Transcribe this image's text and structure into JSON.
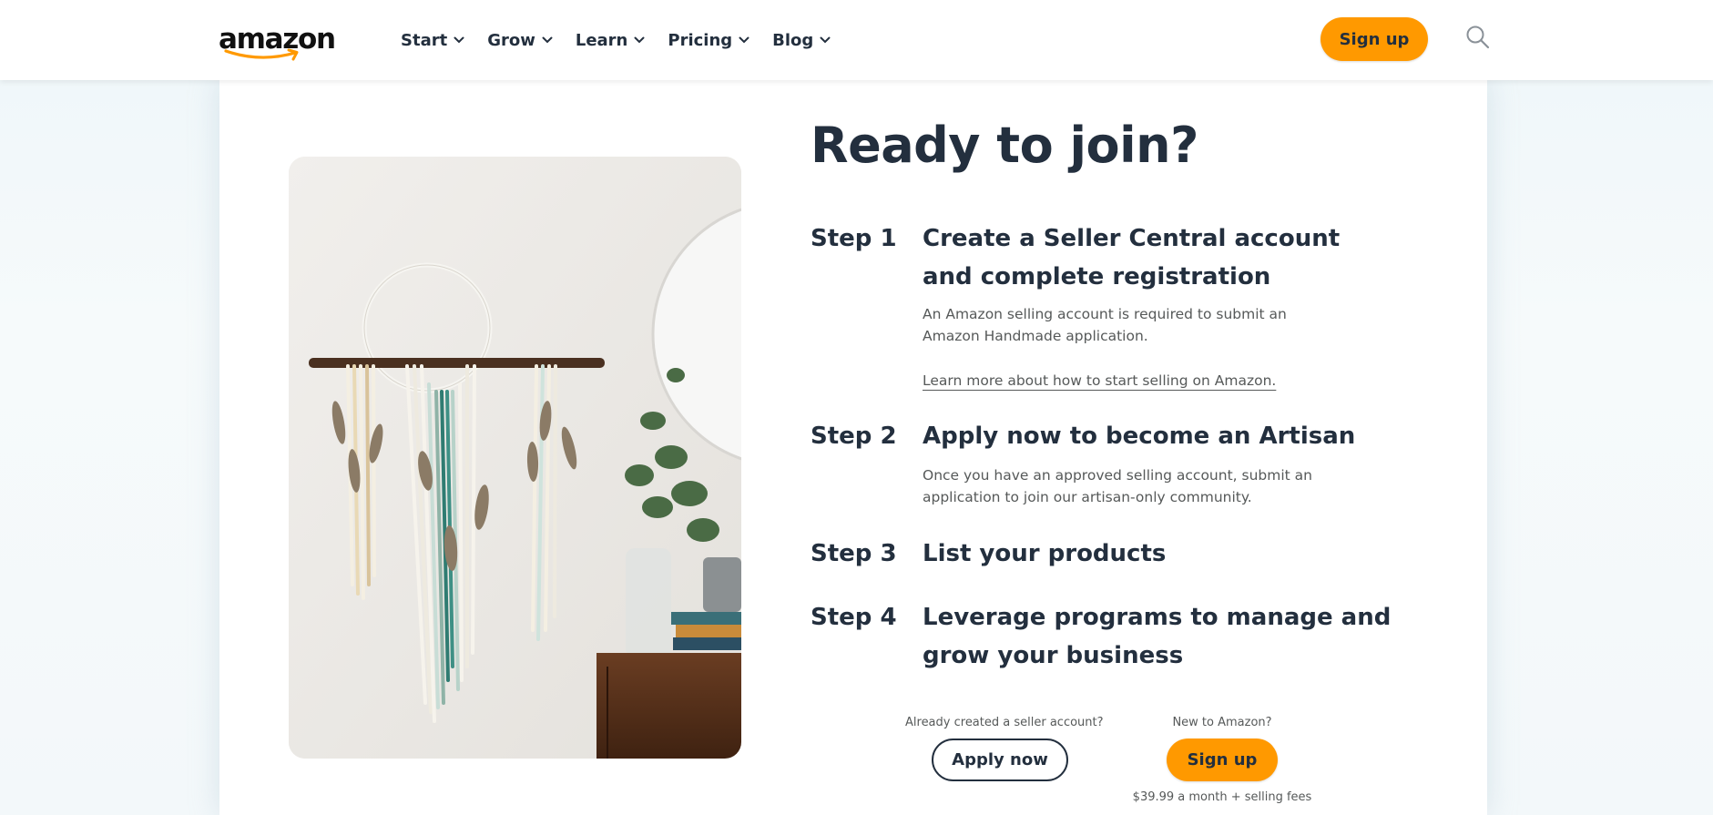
{
  "header": {
    "logo_text": "amazon",
    "nav": [
      {
        "label": "Start"
      },
      {
        "label": "Grow"
      },
      {
        "label": "Learn"
      },
      {
        "label": "Pricing"
      },
      {
        "label": "Blog"
      }
    ],
    "signup_label": "Sign up",
    "search_icon": "search-icon"
  },
  "main": {
    "title": "Ready to join?",
    "steps": [
      {
        "label": "Step 1",
        "title": "Create a Seller Central account and complete registration",
        "description": "An Amazon selling account is required to submit an Amazon Handmade application.",
        "link": "Learn more about how to start selling on Amazon."
      },
      {
        "label": "Step 2",
        "title": "Apply now to become an Artisan",
        "description": "Once you have an approved selling account, submit an application to join our artisan-only community."
      },
      {
        "label": "Step 3",
        "title": "List your products"
      },
      {
        "label": "Step 4",
        "title": "Leverage programs to manage and grow your business"
      }
    ],
    "cta": {
      "existing_caption": "Already created a seller account?",
      "apply_label": "Apply now",
      "new_caption": "New to Amazon?",
      "signup_label": "Sign up",
      "fee_note": "$39.99 a month + selling fees"
    }
  },
  "colors": {
    "accent": "#ff9900",
    "text_dark": "#232f3e",
    "text_muted": "#565959"
  }
}
